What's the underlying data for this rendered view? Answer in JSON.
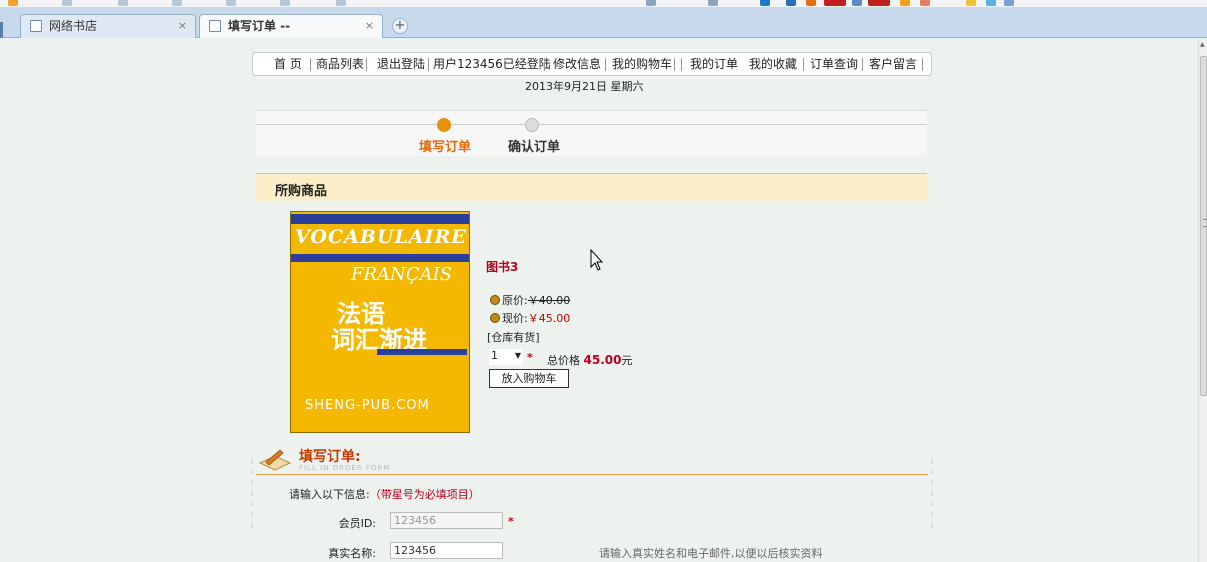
{
  "browser": {
    "tabs": [
      {
        "label": "网络书店",
        "close": "×"
      },
      {
        "label": "填写订单 --",
        "close": "×"
      }
    ],
    "new_tab": "+"
  },
  "nav": {
    "items": [
      "首 页",
      "商品列表",
      "退出登陆",
      "用户123456已经登陆",
      "修改信息",
      "我的购物车",
      "我的订单",
      "我的收藏",
      "订单查询",
      "客户留言"
    ]
  },
  "date": "2013年9月21日  星期六",
  "steps": {
    "step1": "填写订单",
    "step2": "确认订单",
    "active_color": "#e8910c",
    "inactive_color": "#dddddd"
  },
  "products": {
    "header": "所购商品",
    "item": {
      "cover": {
        "line1": "VOCABULAIRE",
        "line2": "FRANÇAIS",
        "line3": "法语",
        "line4": "词汇渐进",
        "line5": "SHENG-PUB.COM"
      },
      "title": "图书3",
      "orig_label": "原价:",
      "orig_price": "￥40.00",
      "now_label": "现价:",
      "now_price": "￥45.00",
      "stock": "[仓库有货]",
      "qty": "1",
      "required_mark": "*",
      "total_label": "总价格",
      "total_value": "45.00",
      "total_unit": "元",
      "add_cart": "放入购物车"
    }
  },
  "order_form": {
    "title": "填写订单:",
    "subtitle": "FILL IN ORDER FORM",
    "intro": "请输入以下信息:",
    "intro_req": "（带星号为必填项目）",
    "member_id_label": "会员ID:",
    "member_id_value": "123456",
    "required_mark": "*",
    "realname_label": "真实名称:",
    "realname_value": "123456",
    "hint": "请输入真实姓名和电子邮件,以便以后核实资料"
  },
  "colors": {
    "accent_red": "#b6001e",
    "header_orange": "#c63a00",
    "product_bar": "#fbeec9",
    "tabbar": "#c7d9ea"
  }
}
